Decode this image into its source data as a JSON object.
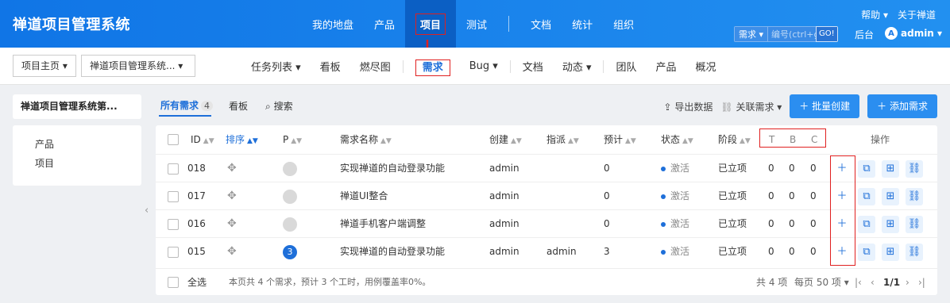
{
  "header": {
    "brand": "禅道项目管理系统",
    "nav": [
      "我的地盘",
      "产品",
      "项目",
      "测试",
      "文档",
      "统计",
      "组织"
    ],
    "active_nav": "项目",
    "help": "帮助 ▾",
    "about": "关于禅道",
    "search_type": "需求 ▾",
    "search_placeholder": "编号(ctrl+g)",
    "search_go": "GO!",
    "backstage": "后台",
    "avatar_letter": "A",
    "user": "admin ▾"
  },
  "subnav": {
    "crumb_home": "项目主页 ▾",
    "crumb_project": "禅道项目管理系统... ▾",
    "items": [
      "任务列表 ▾",
      "看板",
      "燃尽图",
      "需求",
      "Bug ▾",
      "文档",
      "动态 ▾",
      "团队",
      "产品",
      "概况"
    ],
    "active": "需求"
  },
  "left": {
    "title": "禅道项目管理系统第...",
    "links": [
      "产品",
      "项目"
    ]
  },
  "toolbar": {
    "tab_all": "所有需求",
    "tab_all_count": "4",
    "tab_kanban": "看板",
    "tab_search": "搜索",
    "export": "导出数据",
    "link_story": "关联需求 ▾",
    "batch_create": "批量创建",
    "add_story": "添加需求"
  },
  "table": {
    "headers": {
      "id": "ID",
      "order": "排序",
      "pri": "P",
      "title": "需求名称",
      "creator": "创建",
      "assign": "指派",
      "estimate": "预计",
      "status": "状态",
      "stage": "阶段",
      "t": "T",
      "b": "B",
      "c": "C",
      "actions": "操作"
    },
    "rows": [
      {
        "id": "018",
        "pri": "",
        "title": "实现禅道的自动登录功能",
        "creator": "admin",
        "assign": "",
        "estimate": "0",
        "status": "激活",
        "stage": "已立项",
        "t": "0",
        "b": "0",
        "c": "0"
      },
      {
        "id": "017",
        "pri": "",
        "title": "禅道UI整合",
        "creator": "admin",
        "assign": "",
        "estimate": "0",
        "status": "激活",
        "stage": "已立项",
        "t": "0",
        "b": "0",
        "c": "0"
      },
      {
        "id": "016",
        "pri": "",
        "title": "禅道手机客户端调整",
        "creator": "admin",
        "assign": "",
        "estimate": "0",
        "status": "激活",
        "stage": "已立项",
        "t": "0",
        "b": "0",
        "c": "0"
      },
      {
        "id": "015",
        "pri": "3",
        "title": "实现禅道的自动登录功能",
        "creator": "admin",
        "assign": "admin",
        "estimate": "3",
        "status": "激活",
        "stage": "已立项",
        "t": "0",
        "b": "0",
        "c": "0"
      }
    ]
  },
  "footer": {
    "select_all": "全选",
    "summary": "本页共 4 个需求，预计 3 个工时，用例覆盖率0%。",
    "total": "共 4 项",
    "per_page": "每页 50 项 ▾",
    "page": "1/1"
  },
  "colors": {
    "accent": "#1e6fd9",
    "header": "#1a7ae8",
    "highlight": "#e02020"
  }
}
